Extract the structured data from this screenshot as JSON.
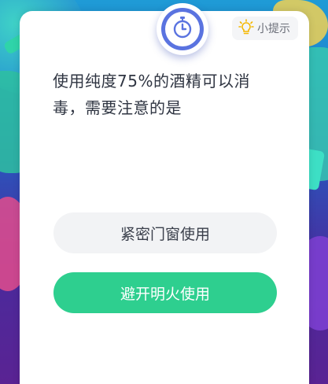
{
  "card": {
    "hint_label": "小提示"
  },
  "question": {
    "text": "使用纯度75%的酒精可以消毒，需要注意的是"
  },
  "options": [
    {
      "label": "紧密门窗使用",
      "selected": false
    },
    {
      "label": "避开明火使用",
      "selected": true
    }
  ],
  "colors": {
    "accent_green": "#2ecf8f",
    "timer_blue": "#5a73e0",
    "hint_bulb": "#f5b800"
  },
  "icons": {
    "timer": "stopwatch-icon",
    "hint": "lightbulb-icon"
  }
}
